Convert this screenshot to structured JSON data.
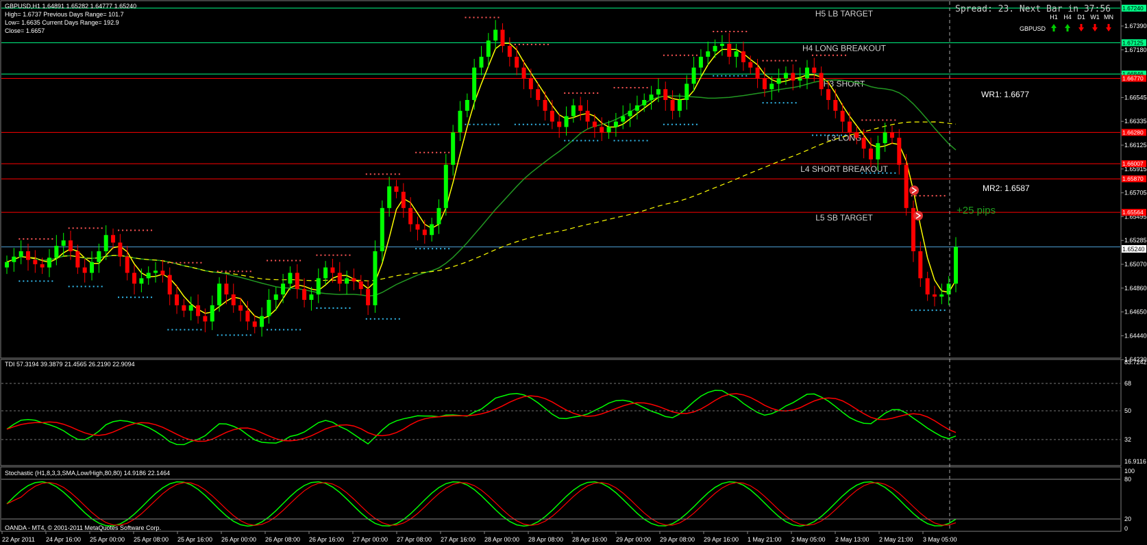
{
  "info": {
    "line1": "GBPUSD,H1  1.64891 1.65282 1.64777 1.65240",
    "line2": "High= 1.6737    Previous Days Range= 101.7",
    "line3": "Low= 1.6635    Current Days Range= 192.9",
    "line4": "Close= 1.6657"
  },
  "spread_text": "Spread: 23. Next Bar in 37:56",
  "timeframe_panel": {
    "symbol": "GBPUSD",
    "timeframes": [
      {
        "label": "H1",
        "dir": "up"
      },
      {
        "label": "H4",
        "dir": "up"
      },
      {
        "label": "D1",
        "dir": "down"
      },
      {
        "label": "W1",
        "dir": "down"
      },
      {
        "label": "MN",
        "dir": "down"
      }
    ]
  },
  "colors": {
    "up": "#00ff00",
    "down": "#ff0000",
    "yellow": "#ffff00",
    "green_ma": "#229922",
    "level_green": "#00ff88",
    "level_red": "#ff0000",
    "level_blue": "#4fa3d8",
    "grid": "#808080"
  },
  "levels": [
    {
      "label": "H5 LB TARGET",
      "price": 1.6745,
      "color": "green"
    },
    {
      "label": "H4 LONG BREAKOUT",
      "price": 1.6713,
      "color": "green"
    },
    {
      "label": "H3 SHORT",
      "price": 1.668,
      "color": "red"
    },
    {
      "label": "",
      "price": 1.6684,
      "color": "green"
    },
    {
      "label": "L3 LONG",
      "price": 1.663,
      "color": "red"
    },
    {
      "label": "L4 SHORT BREAKOUT",
      "price": 1.6601,
      "color": "red"
    },
    {
      "label": "",
      "price": 1.6587,
      "color": "red"
    },
    {
      "label": "L5 SB TARGET",
      "price": 1.6556,
      "color": "red"
    },
    {
      "label": "",
      "price": 1.6524,
      "color": "blue"
    }
  ],
  "level_tags": [
    "1.67240",
    "1.67125",
    "1.66846",
    "1.66770",
    "1.66280",
    "1.66007",
    "1.65870",
    "1.65564"
  ],
  "pivots": [
    {
      "label": "WR1:",
      "value": "1.6677"
    },
    {
      "label": "MR2:",
      "value": "1.6587"
    }
  ],
  "pips_text": "+25 pips",
  "price_axis": [
    "1.67390",
    "1.67180",
    "1.66965",
    "1.66545",
    "1.66335",
    "1.66125",
    "1.65915",
    "1.65705",
    "1.65495",
    "1.65285",
    "1.65070",
    "1.64860",
    "1.64650",
    "1.64440",
    "1.64230"
  ],
  "current_price": "1.65240",
  "time_axis": [
    "22 Apr 2011",
    "24 Apr 16:00",
    "25 Apr 00:00",
    "25 Apr 08:00",
    "25 Apr 16:00",
    "26 Apr 00:00",
    "26 Apr 08:00",
    "26 Apr 16:00",
    "27 Apr 00:00",
    "27 Apr 08:00",
    "27 Apr 16:00",
    "28 Apr 00:00",
    "28 Apr 08:00",
    "28 Apr 16:00",
    "29 Apr 00:00",
    "29 Apr 08:00",
    "29 Apr 16:00",
    "1 May 21:00",
    "2 May 05:00",
    "2 May 13:00",
    "2 May 21:00",
    "3 May 05:00"
  ],
  "tdi": {
    "title": "TDI 57.3194 39.3879 21.4565 26.2190 22.9094",
    "axis": [
      "83.7242",
      "68",
      "50",
      "32",
      "16.9116"
    ]
  },
  "stoch": {
    "title": "Stochastic (H1,8,3,3,SMA,Low/High,80,80) 14.9186 22.1464",
    "axis": [
      "100",
      "80",
      "20",
      "0"
    ]
  },
  "footer": "OANDA - MT4, © 2001-2011 MetaQuotes Software Corp.",
  "chart_data": {
    "type": "candlestick",
    "symbol": "GBPUSD",
    "timeframe": "H1",
    "ylim": [
      1.6423,
      1.675
    ],
    "closes": [
      1.651,
      1.6515,
      1.652,
      1.6512,
      1.6508,
      1.6505,
      1.6514,
      1.6525,
      1.653,
      1.652,
      1.6505,
      1.65,
      1.651,
      1.652,
      1.6535,
      1.6528,
      1.6515,
      1.65,
      1.649,
      1.6495,
      1.65,
      1.6502,
      1.6498,
      1.648,
      1.647,
      1.6465,
      1.647,
      1.646,
      1.6455,
      1.647,
      1.649,
      1.648,
      1.647,
      1.6465,
      1.6455,
      1.645,
      1.646,
      1.6475,
      1.648,
      1.649,
      1.65,
      1.6485,
      1.6475,
      1.648,
      1.6495,
      1.6505,
      1.65,
      1.649,
      1.6495,
      1.6492,
      1.6485,
      1.647,
      1.652,
      1.656,
      1.658,
      1.6575,
      1.656,
      1.6545,
      1.654,
      1.6535,
      1.6545,
      1.656,
      1.66,
      1.663,
      1.665,
      1.666,
      1.669,
      1.67,
      1.6715,
      1.6725,
      1.671,
      1.67,
      1.669,
      1.668,
      1.667,
      1.666,
      1.665,
      1.664,
      1.6635,
      1.6645,
      1.6655,
      1.665,
      1.664,
      1.6635,
      1.663,
      1.6635,
      1.664,
      1.6645,
      1.665,
      1.6655,
      1.666,
      1.6665,
      1.667,
      1.666,
      1.665,
      1.666,
      1.6675,
      1.669,
      1.67,
      1.6705,
      1.671,
      1.6712,
      1.67,
      1.6705,
      1.6695,
      1.669,
      1.668,
      1.667,
      1.6675,
      1.668,
      1.6685,
      1.6678,
      1.668,
      1.669,
      1.6685,
      1.667,
      1.666,
      1.665,
      1.664,
      1.663,
      1.6625,
      1.6615,
      1.6605,
      1.662,
      1.663,
      1.6625,
      1.66,
      1.656,
      1.652,
      1.6495,
      1.648,
      1.6478,
      1.648,
      1.649,
      1.6524
    ]
  }
}
